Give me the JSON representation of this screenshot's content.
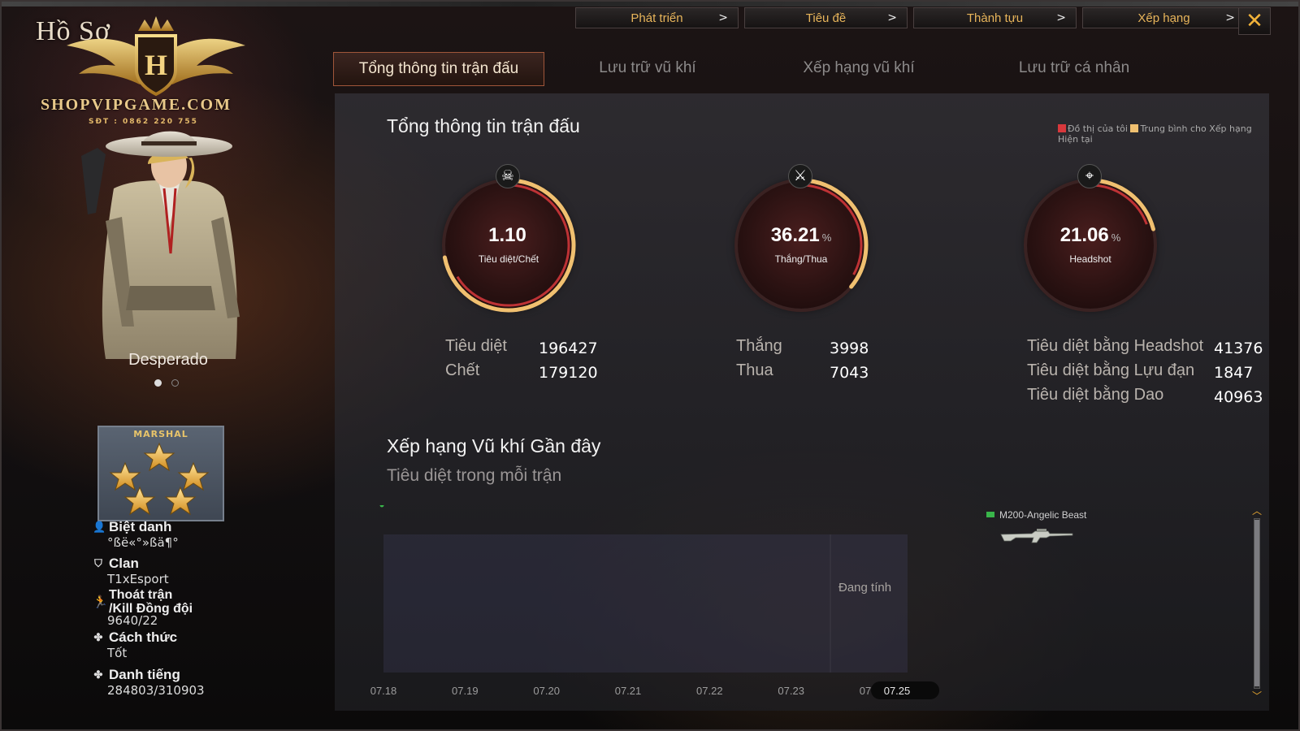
{
  "logo": {
    "title": "Hồ Sơ",
    "brand": "SHOPVIPGAME.COM",
    "phone": "SĐT : 0862 220 755",
    "badge_letter": "H"
  },
  "character": {
    "name": "Desperado"
  },
  "rank": {
    "name": "MARSHAL"
  },
  "profile": {
    "nickname_label": "Biệt danh",
    "nickname_value": "°ßë«°»ßä¶°",
    "clan_label": "Clan",
    "clan_value": "T1xEsport",
    "leave_label_1": "Thoát trận",
    "leave_label_2": "/Kill Đồng đội",
    "leave_value": "9640/22",
    "manner_label": "Cách thức",
    "manner_value": "Tốt",
    "fame_label": "Danh tiếng",
    "fame_value": "284803/310903"
  },
  "top_menu": [
    {
      "label": "Phát triển",
      "arrow": ">"
    },
    {
      "label": "Tiêu đề",
      "arrow": ">"
    },
    {
      "label": "Thành tựu",
      "arrow": ">"
    },
    {
      "label": "Xếp hạng",
      "arrow": ">"
    }
  ],
  "close_glyph": "✕",
  "tabs": [
    {
      "label": "Tổng thông tin trận đấu",
      "active": true
    },
    {
      "label": "Lưu trữ vũ khí",
      "active": false
    },
    {
      "label": "Xếp hạng vũ khí",
      "active": false
    },
    {
      "label": "Lưu trữ cá nhân",
      "active": false
    }
  ],
  "summary": {
    "title": "Tổng thông tin trận đấu",
    "legend_mine": "Đồ thị của tôi",
    "legend_avg": "Trung bình cho Xếp hạng Hiện tại",
    "colors": {
      "mine": "#d8383c",
      "avg": "#f0c070",
      "ring": "#e89a50"
    }
  },
  "gauges": [
    {
      "value": "1.10",
      "unit": "",
      "label": "Tiêu diệt/Chết",
      "fill": 0.72,
      "icon": "skull-icon",
      "glyph": "☠"
    },
    {
      "value": "36.21",
      "unit": "%",
      "label": "Thắng/Thua",
      "fill": 0.36,
      "icon": "crossed-swords-icon",
      "glyph": "⚔"
    },
    {
      "value": "21.06",
      "unit": "%",
      "label": "Headshot",
      "fill": 0.21,
      "icon": "crosshair-icon",
      "glyph": "⌖"
    }
  ],
  "stats": {
    "kills_label": "Tiêu diệt",
    "kills_value": "196427",
    "deaths_label": "Chết",
    "deaths_value": "179120",
    "wins_label": "Thắng",
    "wins_value": "3998",
    "losses_label": "Thua",
    "losses_value": "7043",
    "headshot_label": "Tiêu diệt bằng Headshot",
    "headshot_value": "41376",
    "grenade_label": "Tiêu diệt bằng Lựu đạn",
    "grenade_value": "1847",
    "knife_label": "Tiêu diệt bằng Dao",
    "knife_value": "40963"
  },
  "recent": {
    "title": "Xếp hạng Vũ khí Gần đây",
    "subtitle": "Tiêu diệt trong mỗi trận",
    "pending_label": "Đang tính",
    "weapon_name": "M200-Angelic Beast",
    "weapon_color": "#39b54a"
  },
  "chart_data": {
    "type": "bar",
    "categories": [
      "07.18",
      "07.19",
      "07.20",
      "07.21",
      "07.22",
      "07.23",
      "07.24",
      "07.25"
    ],
    "series": [
      {
        "name": "M200-Angelic Beast",
        "values": [
          null,
          null,
          null,
          null,
          null,
          null,
          null,
          null
        ]
      }
    ],
    "selected_category": "07.25",
    "annotation": "Đang tính"
  },
  "scrollbar": {
    "up": "︿",
    "down": "﹀"
  }
}
